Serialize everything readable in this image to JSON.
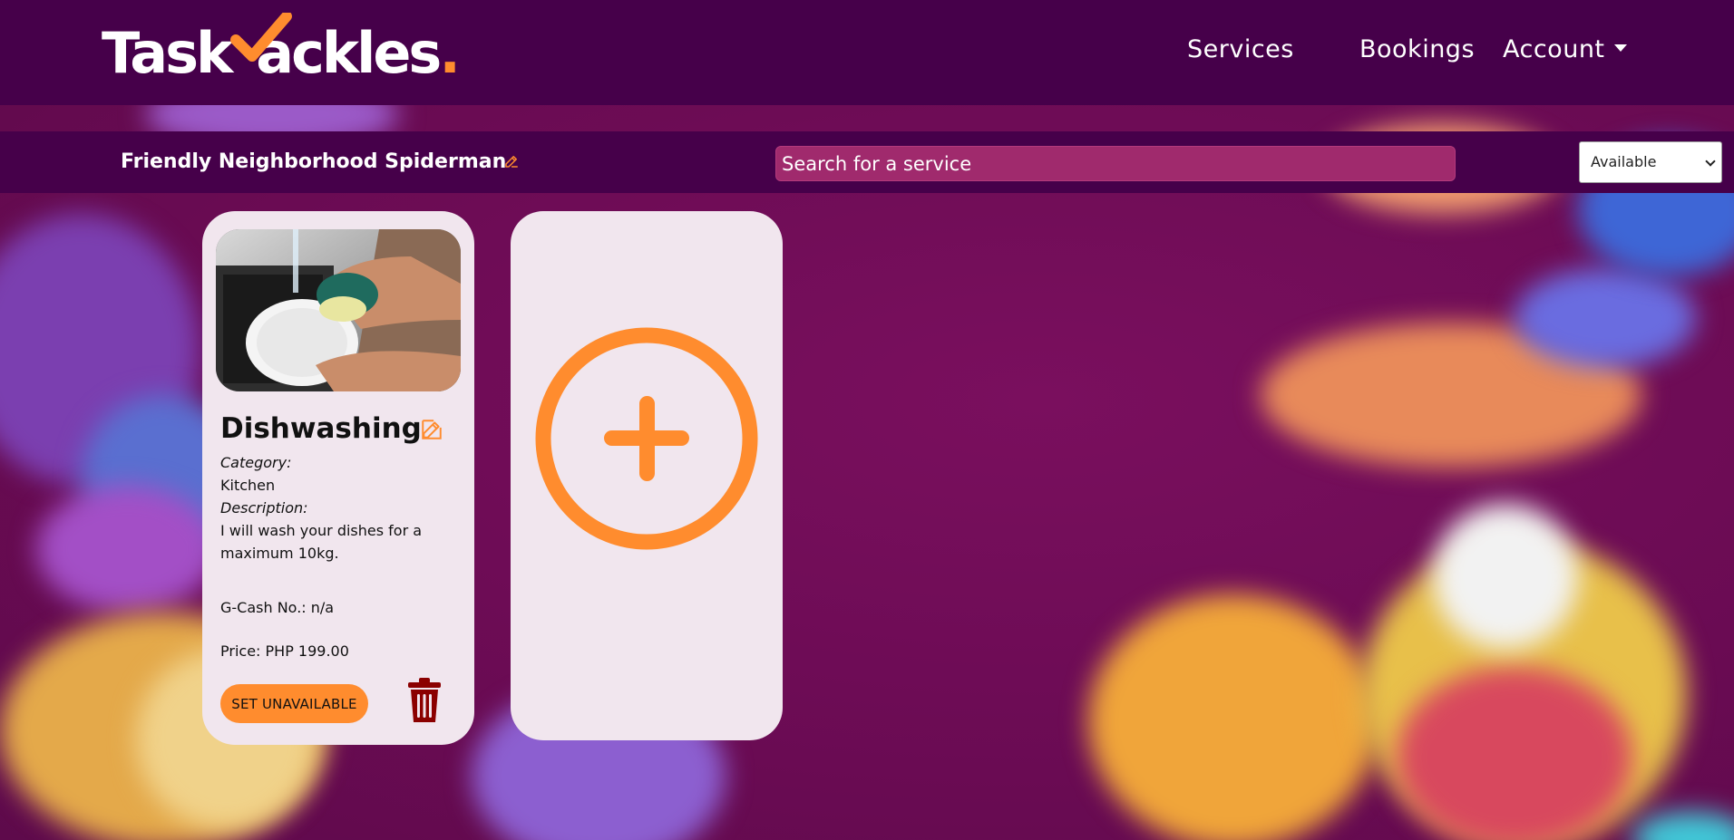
{
  "header": {
    "logo_text_left": "Task",
    "logo_text_right": "ackles",
    "logo_dot": ".",
    "nav": {
      "services": "Services",
      "bookings": "Bookings",
      "account": "Account"
    }
  },
  "subbar": {
    "username": "Friendly Neighborhood Spiderman",
    "search_placeholder": "Search for a service",
    "status_selected": "Available"
  },
  "service_card": {
    "title": "Dishwashing",
    "category_label": "Category:",
    "category_value": "Kitchen",
    "description_label": "Description:",
    "description_value": "I will wash your dishes for a maximum 10kg.",
    "gcash": "G-Cash No.: n/a",
    "price": "Price: PHP 199.00",
    "button_label": "SET UNAVAILABLE"
  },
  "colors": {
    "header_bg": "#46004a",
    "page_bg": "#6e0d57",
    "accent": "#ff8c2e",
    "card_bg": "#f1e6ee",
    "search_bg": "#a02a6d",
    "trash": "#8b0000"
  },
  "icons": [
    "check-icon",
    "edit-icon",
    "trash-icon",
    "plus-circle-icon",
    "caret-down-icon"
  ]
}
